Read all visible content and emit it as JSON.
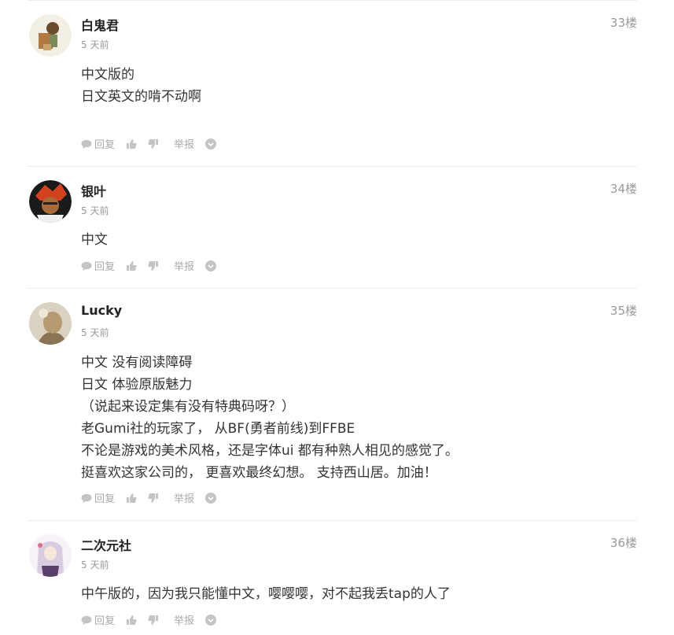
{
  "comments": [
    {
      "username": "白鬼君",
      "time": "5 天前",
      "floor": "33楼",
      "lines": [
        "中文版的",
        "日文英文的啃不动啊"
      ],
      "actions": {
        "reply": "回复",
        "report": "举报"
      }
    },
    {
      "username": "银叶",
      "time": "5 天前",
      "floor": "34楼",
      "lines": [
        "中文"
      ],
      "actions": {
        "reply": "回复",
        "report": "举报"
      }
    },
    {
      "username": "Lucky",
      "time": "5 天前",
      "floor": "35楼",
      "lines": [
        "中文 没有阅读障碍",
        "日文 体验原版魅力",
        "（说起来设定集有没有特典码呀？）",
        "老Gumi社的玩家了， 从BF(勇者前线)到FFBE",
        "不论是游戏的美术风格，还是字体ui 都有种熟人相见的感觉了。",
        "挺喜欢这家公司的， 更喜欢最终幻想。 支持西山居。加油！"
      ],
      "actions": {
        "reply": "回复",
        "report": "举报"
      }
    },
    {
      "username": "二次元社",
      "time": "5 天前",
      "floor": "36楼",
      "lines": [
        "中午版的，因为我只能懂中文，嘤嘤嘤，对不起我丢tap的人了"
      ],
      "actions": {
        "reply": "回复",
        "report": "举报"
      }
    }
  ]
}
